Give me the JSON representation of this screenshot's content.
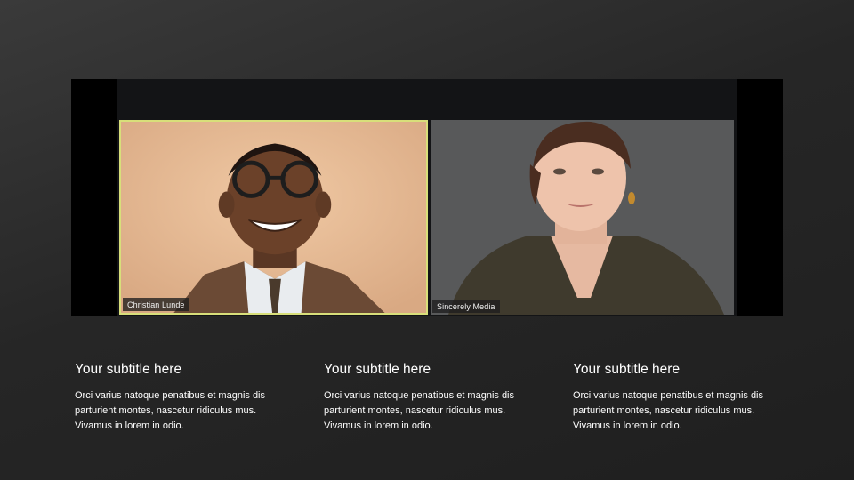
{
  "video_call": {
    "participants": [
      {
        "name": "Christian Lunde",
        "active_speaker": true,
        "highlight_color": "#d8df7a"
      },
      {
        "name": "Sincerely Media",
        "active_speaker": false
      }
    ]
  },
  "columns": [
    {
      "subtitle": "Your subtitle here",
      "text": "Orci varius natoque penatibus et magnis dis parturient montes, nascetur ridiculus mus. Vivamus in lorem in odio."
    },
    {
      "subtitle": "Your subtitle here",
      "text": "Orci varius natoque penatibus et magnis dis parturient montes, nascetur ridiculus mus. Vivamus in lorem in odio."
    },
    {
      "subtitle": "Your subtitle here",
      "text": "Orci varius natoque penatibus et magnis dis parturient montes, nascetur ridiculus mus. Vivamus in lorem in odio."
    }
  ]
}
